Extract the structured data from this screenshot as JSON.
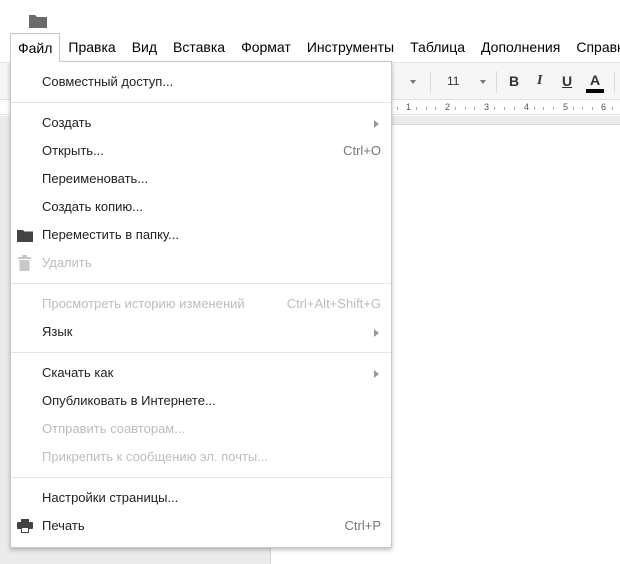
{
  "menubar": {
    "items": [
      "Файл",
      "Правка",
      "Вид",
      "Вставка",
      "Формат",
      "Инструменты",
      "Таблица",
      "Дополнения",
      "Справка"
    ]
  },
  "toolbar": {
    "font_size": "11",
    "bold": "B",
    "italic": "I",
    "underline": "U",
    "text_color": "A"
  },
  "ruler": {
    "labels": [
      "1",
      "2",
      "3",
      "4",
      "5",
      "6"
    ]
  },
  "file_menu": {
    "share": "Совместный доступ...",
    "create": "Создать",
    "open": "Открыть...",
    "open_shortcut": "Ctrl+O",
    "rename": "Переименовать...",
    "make_copy": "Создать копию...",
    "move_to_folder": "Переместить в папку...",
    "delete": "Удалить",
    "revision_history": "Просмотреть историю изменений",
    "revision_history_shortcut": "Ctrl+Alt+Shift+G",
    "language": "Язык",
    "download_as": "Скачать как",
    "publish": "Опубликовать в Интернете...",
    "email_collaborators": "Отправить соавторам...",
    "email_attachment": "Прикрепить к сообщению эл. почты...",
    "page_setup": "Настройки страницы...",
    "print": "Печать",
    "print_shortcut": "Ctrl+P"
  },
  "icons": {
    "folder": "folder-icon",
    "trash": "trash-icon",
    "printer": "printer-icon"
  }
}
